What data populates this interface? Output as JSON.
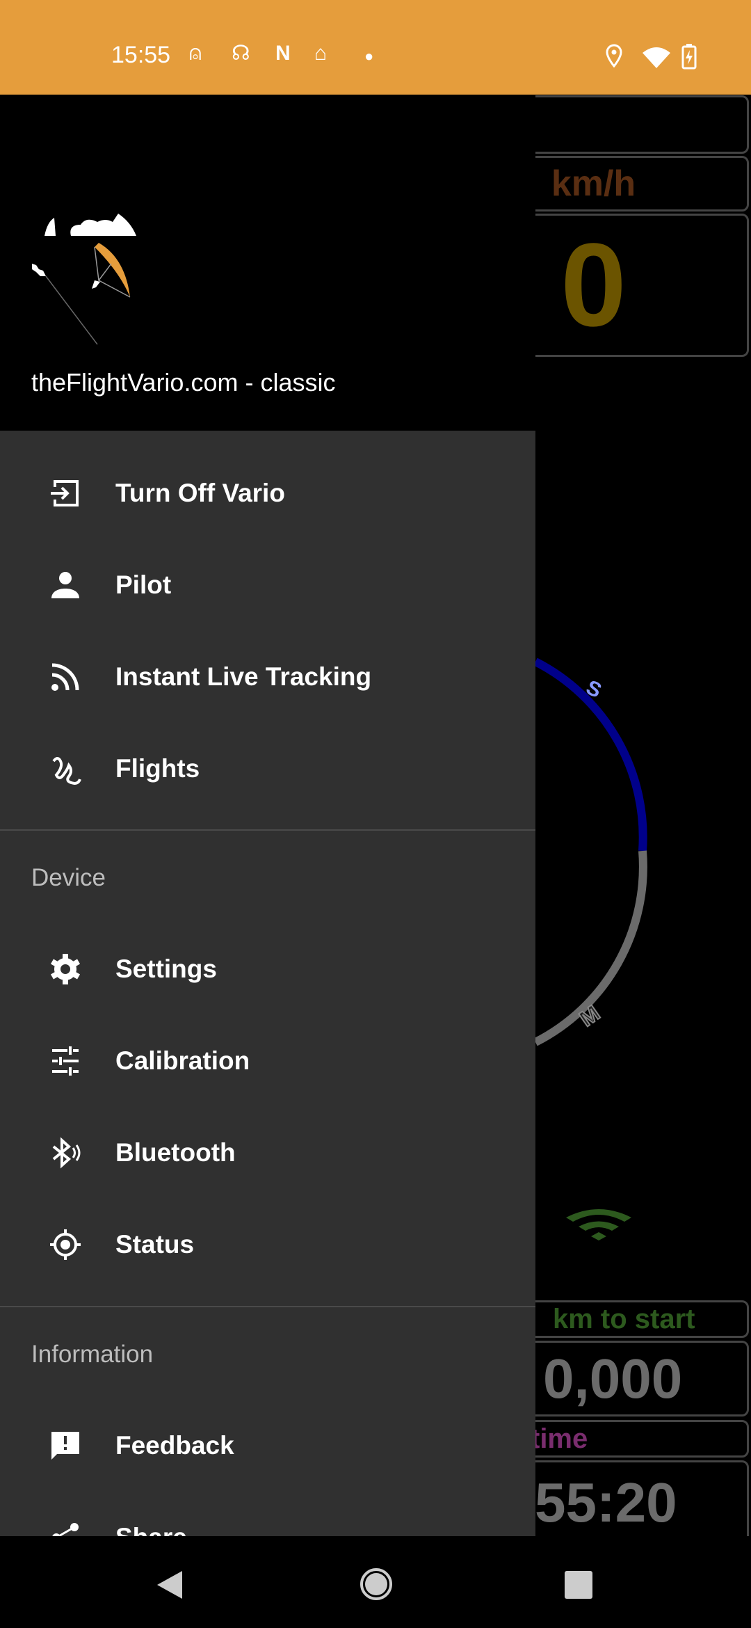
{
  "status_bar": {
    "time": "15:55",
    "icons": [
      "sim-icon",
      "hearing-icon",
      "netflix-icon",
      "home-icon",
      "dot-icon",
      "location-icon",
      "wifi-icon",
      "battery-charging-icon"
    ],
    "color": "#e59d3c"
  },
  "background": {
    "speed_unit": "km/h",
    "speed_value": "0",
    "compass_labels": [
      "S",
      "M"
    ],
    "distance_label": "km to start",
    "distance_value": "0,000",
    "time_label": "time",
    "time_value": "55:20"
  },
  "drawer": {
    "title": "theFlightVario.com - classic",
    "main_items": [
      {
        "label": "Turn Off Vario",
        "icon": "exit-icon"
      },
      {
        "label": "Pilot",
        "icon": "person-icon"
      },
      {
        "label": "Instant Live Tracking",
        "icon": "rss-icon"
      },
      {
        "label": "Flights",
        "icon": "flight-path-icon"
      }
    ],
    "device_header": "Device",
    "device_items": [
      {
        "label": "Settings",
        "icon": "gear-icon"
      },
      {
        "label": "Calibration",
        "icon": "sliders-icon"
      },
      {
        "label": "Bluetooth",
        "icon": "bluetooth-icon"
      },
      {
        "label": "Status",
        "icon": "gps-fixed-icon"
      }
    ],
    "information_header": "Information",
    "information_items": [
      {
        "label": "Feedback",
        "icon": "feedback-icon"
      },
      {
        "label": "Share",
        "icon": "share-icon"
      }
    ]
  },
  "nav_bar": {
    "buttons": [
      "back",
      "home",
      "recents"
    ]
  }
}
